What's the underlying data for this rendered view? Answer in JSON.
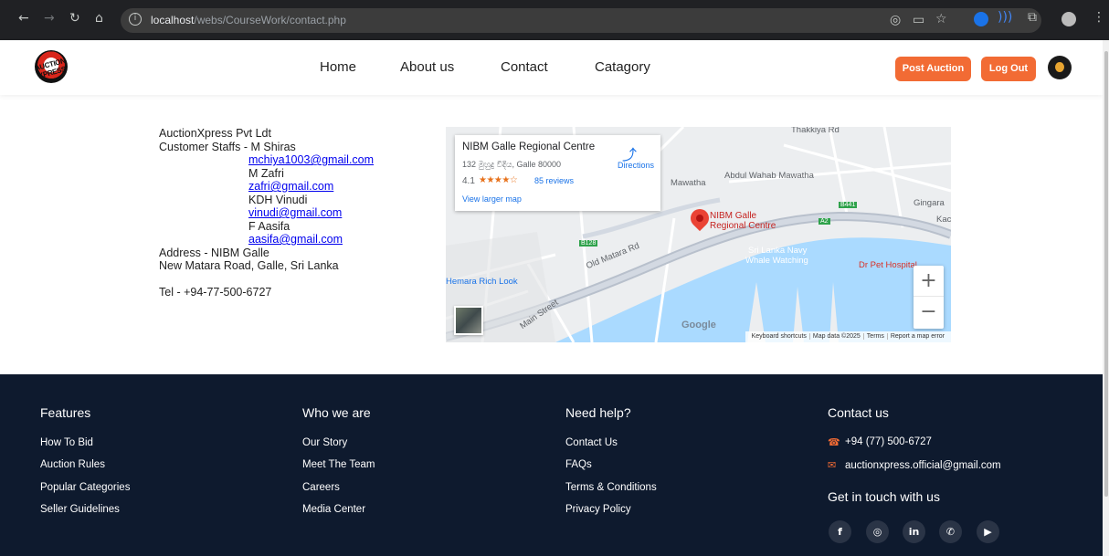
{
  "browser": {
    "url_host": "localhost",
    "url_path": "/webs/CourseWork/contact.php"
  },
  "header": {
    "logo_text": "AUCTION XPRESS",
    "nav": [
      "Home",
      "About us",
      "Contact",
      "Catagory"
    ],
    "post_auction_label": "Post Auction",
    "logout_label": "Log Out"
  },
  "contact": {
    "company": "AuctionXpress Pvt Ldt",
    "staff_prefix": "Customer Staffs - M Shiras",
    "staff": [
      {
        "email": "mchiya1003@gmail.com",
        "next_name": "M Zafri"
      },
      {
        "email": "zafri@gmail.com",
        "next_name": "KDH Vinudi"
      },
      {
        "email": "vinudi@gmail.com",
        "next_name": "F Aasifa"
      },
      {
        "email": "aasifa@gmail.com",
        "next_name": ""
      }
    ],
    "address_line1": "Address - NIBM Galle",
    "address_line2": "New Matara Road, Galle, Sri Lanka",
    "tel": "Tel - +94-77-500-6727"
  },
  "map": {
    "place_name": "NIBM Galle Regional Centre",
    "place_address": "132 මුහුදු වීදිය, Galle 80000",
    "rating": "4.1",
    "stars": "★★★★☆",
    "reviews": "85 reviews",
    "larger_map": "View larger map",
    "directions": "Directions",
    "labels": {
      "thakkiya": "Thakkiya Rd",
      "mawatha": "Mawatha",
      "abdul": "Abdul Wahab Mawatha",
      "nibm_pin_1": "NIBM Galle",
      "nibm_pin_2": "Regional Centre",
      "navy_1": "Sri Lanka Navy",
      "navy_2": "Whale Watching",
      "hospital": "Dr Pet Hospital",
      "gingarala": "Gingara",
      "kac": "Kac",
      "old_matara": "Old Matara Rd",
      "rich_look": "Hemara Rich Look",
      "main_street": "Main Street",
      "b128": "B128",
      "b441": "B441",
      "a2": "A2"
    },
    "google": "Google",
    "attribution": [
      "Keyboard shortcuts",
      "Map data ©2025",
      "Terms",
      "Report a map error"
    ]
  },
  "footer": {
    "features": {
      "title": "Features",
      "links": [
        "How To Bid",
        "Auction Rules",
        "Popular Categories",
        "Seller Guidelines"
      ]
    },
    "who": {
      "title": "Who we are",
      "links": [
        "Our Story",
        "Meet The Team",
        "Careers",
        "Media Center"
      ]
    },
    "help": {
      "title": "Need help?",
      "links": [
        "Contact Us",
        "FAQs",
        "Terms & Conditions",
        "Privacy Policy"
      ]
    },
    "contact": {
      "title": "Contact us",
      "phone": "+94 (77) 500-6727",
      "email": "auctionxpress.official@gmail.com",
      "get_in_touch": "Get in touch with us"
    },
    "social_icons": [
      "facebook-icon",
      "instagram-icon",
      "linkedin-icon",
      "whatsapp-icon",
      "youtube-icon"
    ]
  },
  "colors": {
    "accent": "#f26b34",
    "footer_bg": "#0e1a2e",
    "link": "#0000ee"
  }
}
